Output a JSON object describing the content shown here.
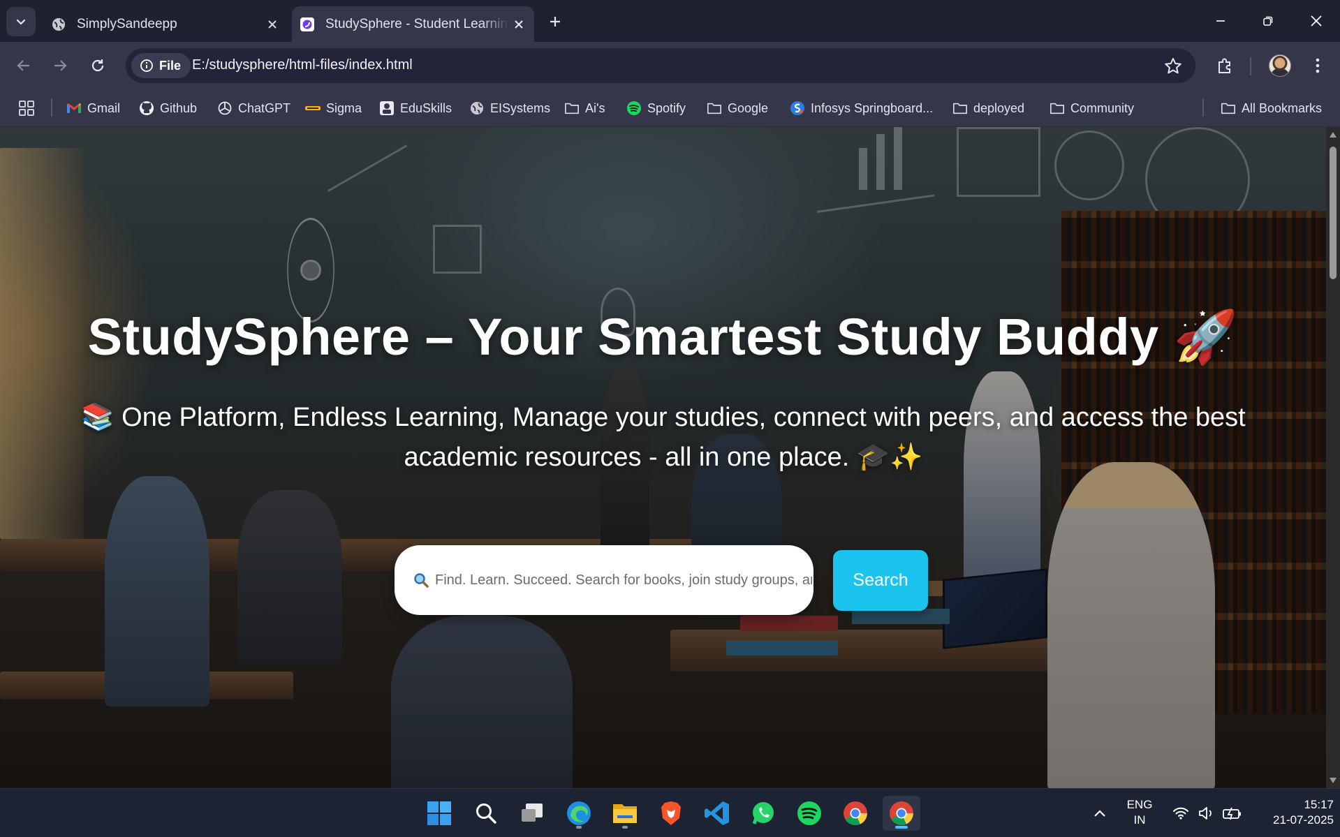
{
  "browser": {
    "tabs": [
      {
        "title": "SimplySandeepp",
        "active": false
      },
      {
        "title": "StudySphere - Student Learning",
        "active": true
      }
    ],
    "address": {
      "chip_label": "File",
      "url": "E:/studysphere/html-files/index.html"
    },
    "bookmarks": [
      {
        "label": "Gmail",
        "icon": "gmail-icon"
      },
      {
        "label": "Github",
        "icon": "github-icon"
      },
      {
        "label": "ChatGPT",
        "icon": "chatgpt-icon"
      },
      {
        "label": "Sigma",
        "icon": "sigma-icon"
      },
      {
        "label": "EduSkills",
        "icon": "eduskills-icon"
      },
      {
        "label": "EISystems",
        "icon": "globe-icon"
      },
      {
        "label": "Ai's",
        "icon": "folder-icon"
      },
      {
        "label": "Spotify",
        "icon": "spotify-icon"
      },
      {
        "label": "Google",
        "icon": "folder-icon"
      },
      {
        "label": "Infosys Springboard...",
        "icon": "springboard-icon"
      },
      {
        "label": "deployed",
        "icon": "folder-icon"
      },
      {
        "label": "Community",
        "icon": "folder-icon"
      }
    ],
    "all_bookmarks_label": "All Bookmarks"
  },
  "page": {
    "title": "StudySphere – Your Smartest Study Buddy 🚀",
    "subtitle": "📚 One Platform, Endless Learning, Manage your studies, connect with peers, and access the best academic resources - all in one place. 🎓✨",
    "search": {
      "placeholder": "Find. Learn. Succeed. Search for books, join study groups, and more...",
      "button_label": "Search"
    }
  },
  "taskbar": {
    "apps": [
      "windows-start-icon",
      "search-icon",
      "task-view-icon",
      "edge-icon",
      "file-explorer-icon",
      "brave-icon",
      "vscode-icon",
      "whatsapp-icon",
      "spotify-icon",
      "chrome-icon",
      "chrome-active-icon"
    ],
    "language_line1": "ENG",
    "language_line2": "IN",
    "time": "15:17",
    "date": "21-07-2025"
  },
  "colors": {
    "search_button": "#1bc4ef",
    "browser_chrome": "#35364a",
    "taskbar": "#1c2333"
  }
}
